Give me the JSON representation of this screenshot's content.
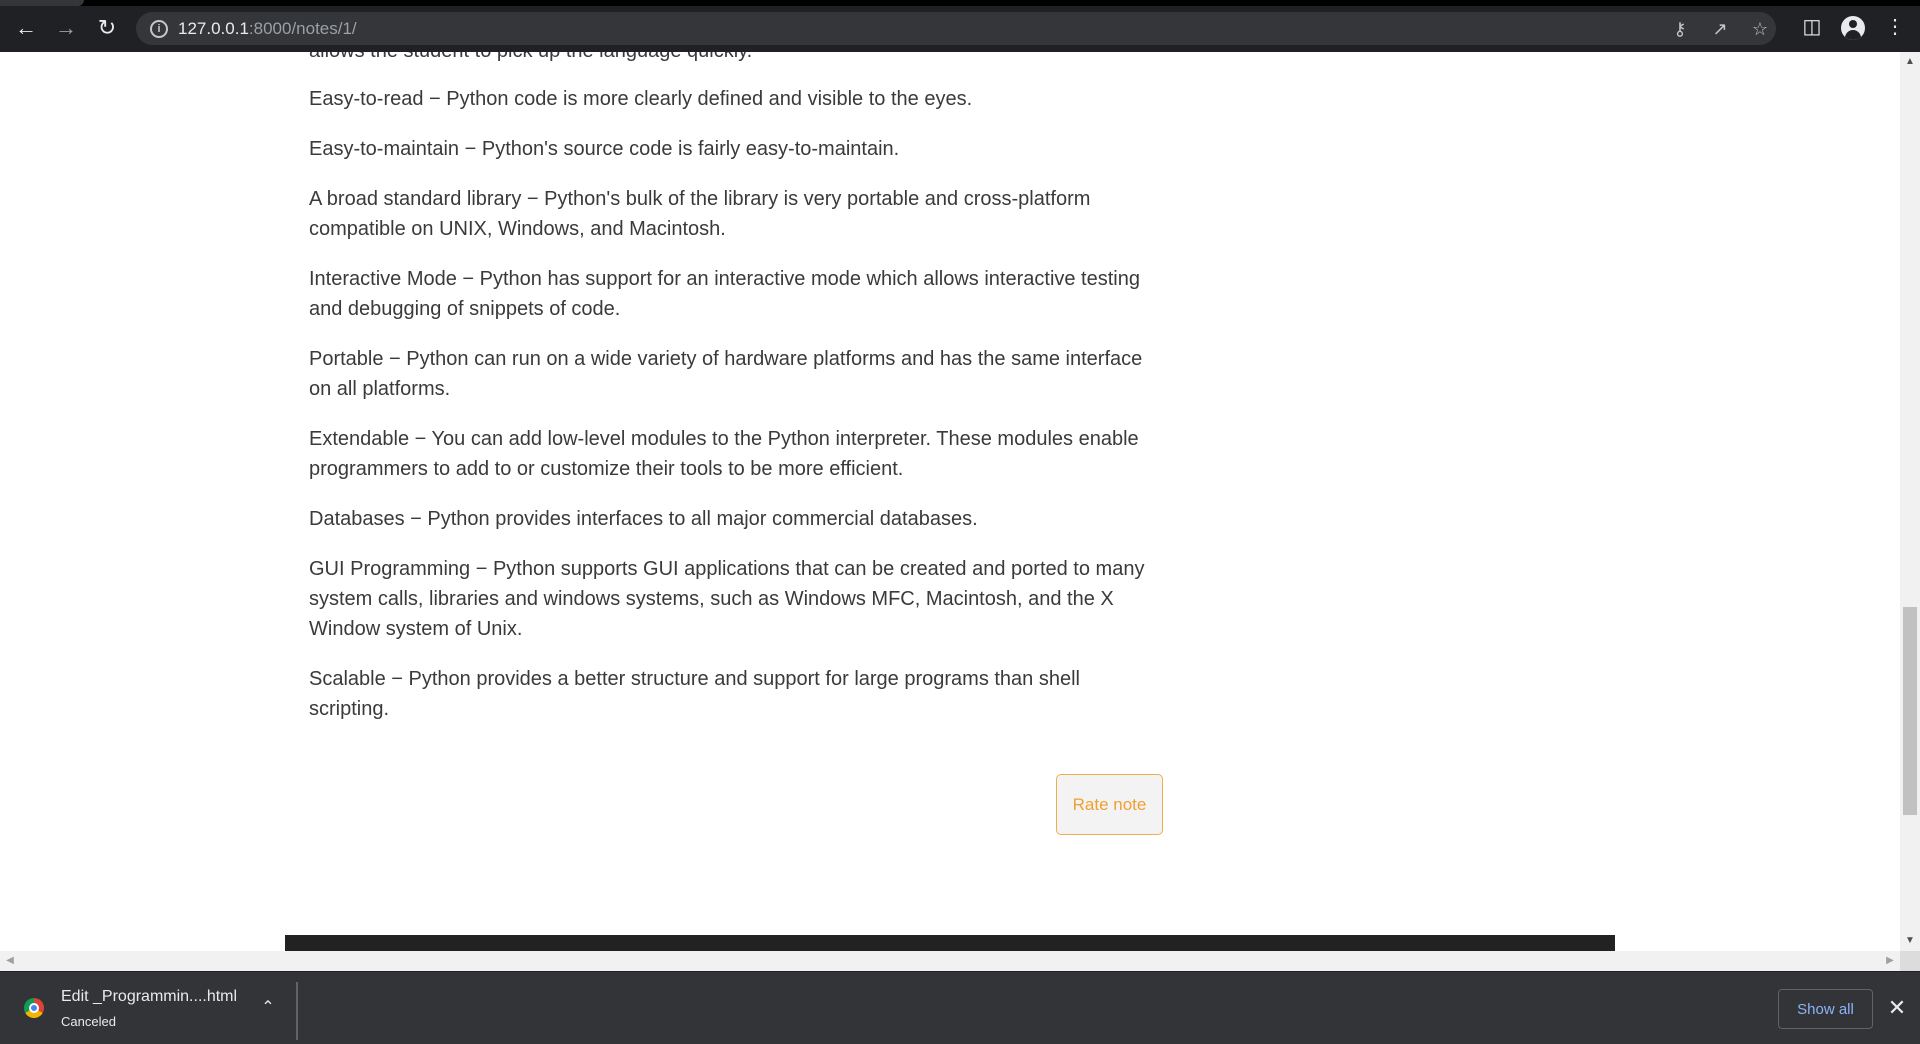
{
  "browser": {
    "url_host": "127.0.0.1",
    "url_path": ":8000/notes/1/",
    "icons": {
      "back": "arrow-left-icon",
      "forward": "arrow-right-icon",
      "reload": "reload-icon",
      "info": "info-icon",
      "key": "key-icon",
      "share": "share-icon",
      "bookmark": "star-icon",
      "sidepanel": "side-panel-icon",
      "profile": "profile-icon",
      "menu": "kebab-menu-icon"
    }
  },
  "article": {
    "cutoff_line": "allows the student to pick up the language quickly.",
    "paragraphs": [
      "Easy-to-read − Python code is more clearly defined and visible to the eyes.",
      "Easy-to-maintain − Python's source code is fairly easy-to-maintain.",
      "A broad standard library − Python's bulk of the library is very portable and cross-platform compatible on UNIX, Windows, and Macintosh.",
      "Interactive Mode − Python has support for an interactive mode which allows interactive testing and debugging of snippets of code.",
      "Portable − Python can run on a wide variety of hardware platforms and has the same interface on all platforms.",
      "Extendable − You can add low-level modules to the Python interpreter. These modules enable programmers to add to or customize their tools to be more efficient.",
      "Databases − Python provides interfaces to all major commercial databases.",
      "GUI Programming − Python supports GUI applications that can be created and ported to many system calls, libraries and windows systems, such as Windows MFC, Macintosh, and the X Window system of Unix.",
      "Scalable − Python provides a better structure and support for large programs than shell scripting."
    ],
    "rate_button": "Rate note"
  },
  "downloads": {
    "filename": "Edit _Programmin....html",
    "status": "Canceled",
    "show_all": "Show all"
  },
  "colors": {
    "accent": "#f0a030",
    "link": "#8ab4f8",
    "topbar": "#202124",
    "shelf": "#333437"
  }
}
